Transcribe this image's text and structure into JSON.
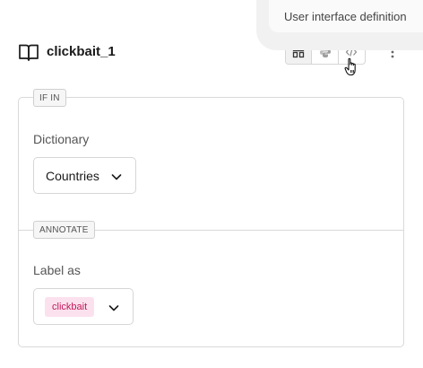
{
  "header": {
    "title": "clickbait_1",
    "title_icon": "book-open-icon",
    "view_toggle": [
      {
        "name": "form-view",
        "icon": "form-layout-icon",
        "active": true
      },
      {
        "name": "python-view",
        "icon": "python-icon",
        "active": false
      },
      {
        "name": "code-view",
        "icon": "code-icon",
        "active": false
      }
    ],
    "more_icon": "kebab-icon"
  },
  "tooltip": {
    "text": "User interface definition"
  },
  "rule": {
    "condition_section": {
      "tag": "IF IN",
      "field_label": "Dictionary",
      "selected_value": "Countries"
    },
    "action_section": {
      "tag": "ANNOTATE",
      "field_label": "Label as",
      "selected_label": "clickbait",
      "label_color": "#c2185b",
      "label_bg": "#fbe1ee"
    }
  }
}
